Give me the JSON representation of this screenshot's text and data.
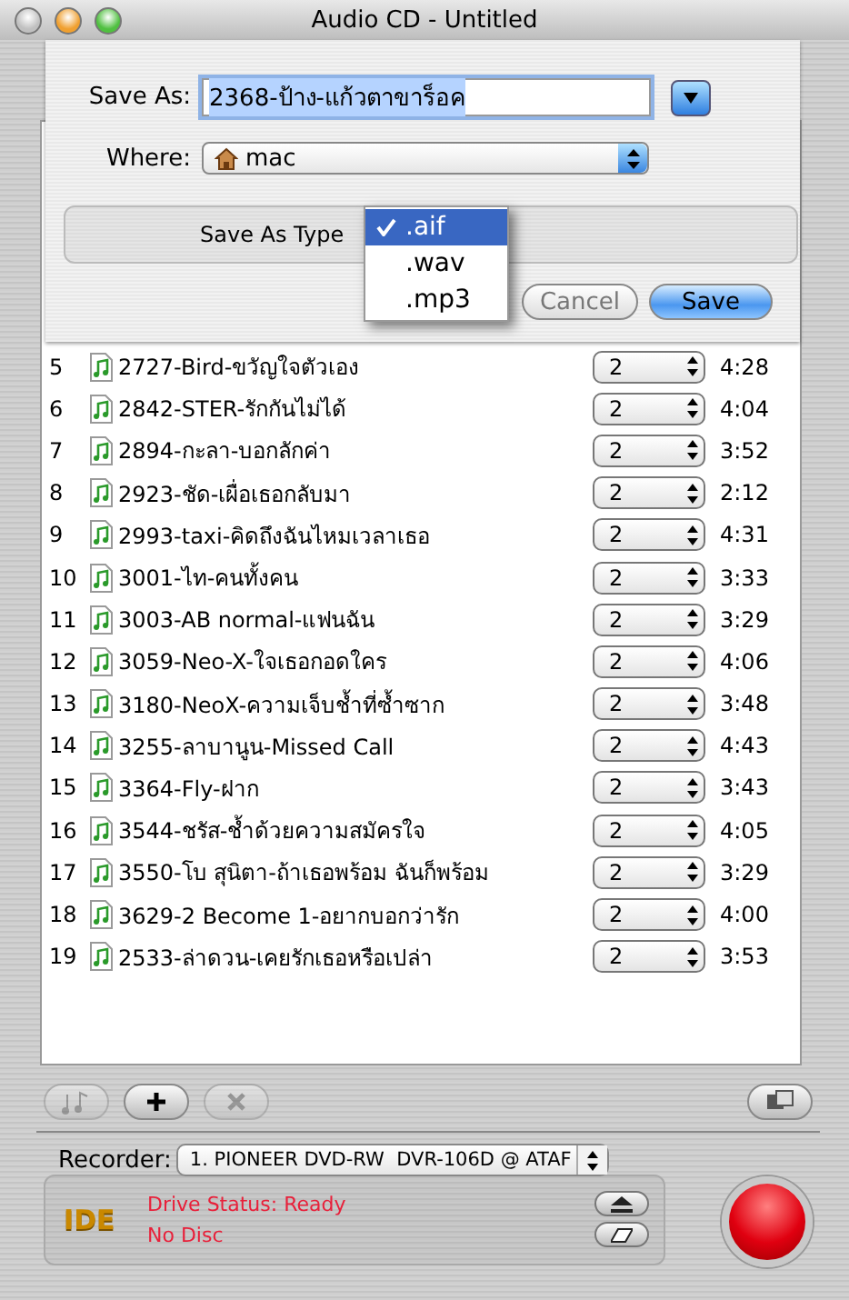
{
  "window": {
    "title": "Audio CD - Untitled"
  },
  "save_sheet": {
    "save_as": {
      "label": "Save As:",
      "value": "2368-ป้าง-แก้วตาขาร็อค"
    },
    "where": {
      "label": "Where:",
      "value": "mac"
    },
    "type": {
      "label": "Save As Type",
      "options": [
        {
          "label": ".aif",
          "selected": true
        },
        {
          "label": ".wav",
          "selected": false
        },
        {
          "label": ".mp3",
          "selected": false
        }
      ]
    },
    "buttons": [
      {
        "label": "Cancel",
        "kind": "cancel"
      },
      {
        "label": "Save",
        "kind": "default"
      }
    ]
  },
  "tracks": [
    {
      "number": "5",
      "title": "2727-Bird-ขวัญใจตัวเอง",
      "pause": "2",
      "length": "4:28"
    },
    {
      "number": "6",
      "title": "2842-STER-รักกันไม่ได้",
      "pause": "2",
      "length": "4:04"
    },
    {
      "number": "7",
      "title": "2894-กะลา-บอกลักค่า",
      "pause": "2",
      "length": "3:52"
    },
    {
      "number": "8",
      "title": "2923-ชัด-เผื่อเธอกลับมา",
      "pause": "2",
      "length": "2:12"
    },
    {
      "number": "9",
      "title": "2993-taxi-คิดถึงฉันไหมเวลาเธอ",
      "pause": "2",
      "length": "4:31"
    },
    {
      "number": "10",
      "title": "3001-ไท-คนทั้งคน",
      "pause": "2",
      "length": "3:33"
    },
    {
      "number": "11",
      "title": "3003-AB normal-แฟนฉัน",
      "pause": "2",
      "length": "3:29"
    },
    {
      "number": "12",
      "title": "3059-Neo-X-ใจเธอกอดใคร",
      "pause": "2",
      "length": "4:06"
    },
    {
      "number": "13",
      "title": "3180-NeoX-ความเจ็บช้ำที่ซ้ำซาก",
      "pause": "2",
      "length": "3:48"
    },
    {
      "number": "14",
      "title": "3255-ลาบานูน-Missed Call",
      "pause": "2",
      "length": "4:43"
    },
    {
      "number": "15",
      "title": "3364-Fly-ฝาก",
      "pause": "2",
      "length": "3:43"
    },
    {
      "number": "16",
      "title": "3544-ชรัส-ช้ำด้วยความสมัครใจ",
      "pause": "2",
      "length": "4:05"
    },
    {
      "number": "17",
      "title": "3550-โบ สุนิตา-ถ้าเธอพร้อม ฉันก็พร้อม",
      "pause": "2",
      "length": "3:29"
    },
    {
      "number": "18",
      "title": "3629-2 Become 1-อยากบอกว่ารัก",
      "pause": "2",
      "length": "4:00"
    },
    {
      "number": "19",
      "title": "2533-ล่าดวน-เคยรักเธอหรือเปล่า",
      "pause": "2",
      "length": "3:53"
    }
  ],
  "toolbar": [
    {
      "kind": "music",
      "disabled": true
    },
    {
      "kind": "add",
      "disabled": false
    },
    {
      "kind": "remove",
      "disabled": true
    },
    {
      "kind": "view",
      "disabled": false
    }
  ],
  "recorder": {
    "label": "Recorder:",
    "value": "1. PIONEER DVD-RW  DVR-106D @ ATAF"
  },
  "drive": {
    "badge": "IDE",
    "status": [
      "Drive Status: Ready",
      "No Disc"
    ]
  }
}
